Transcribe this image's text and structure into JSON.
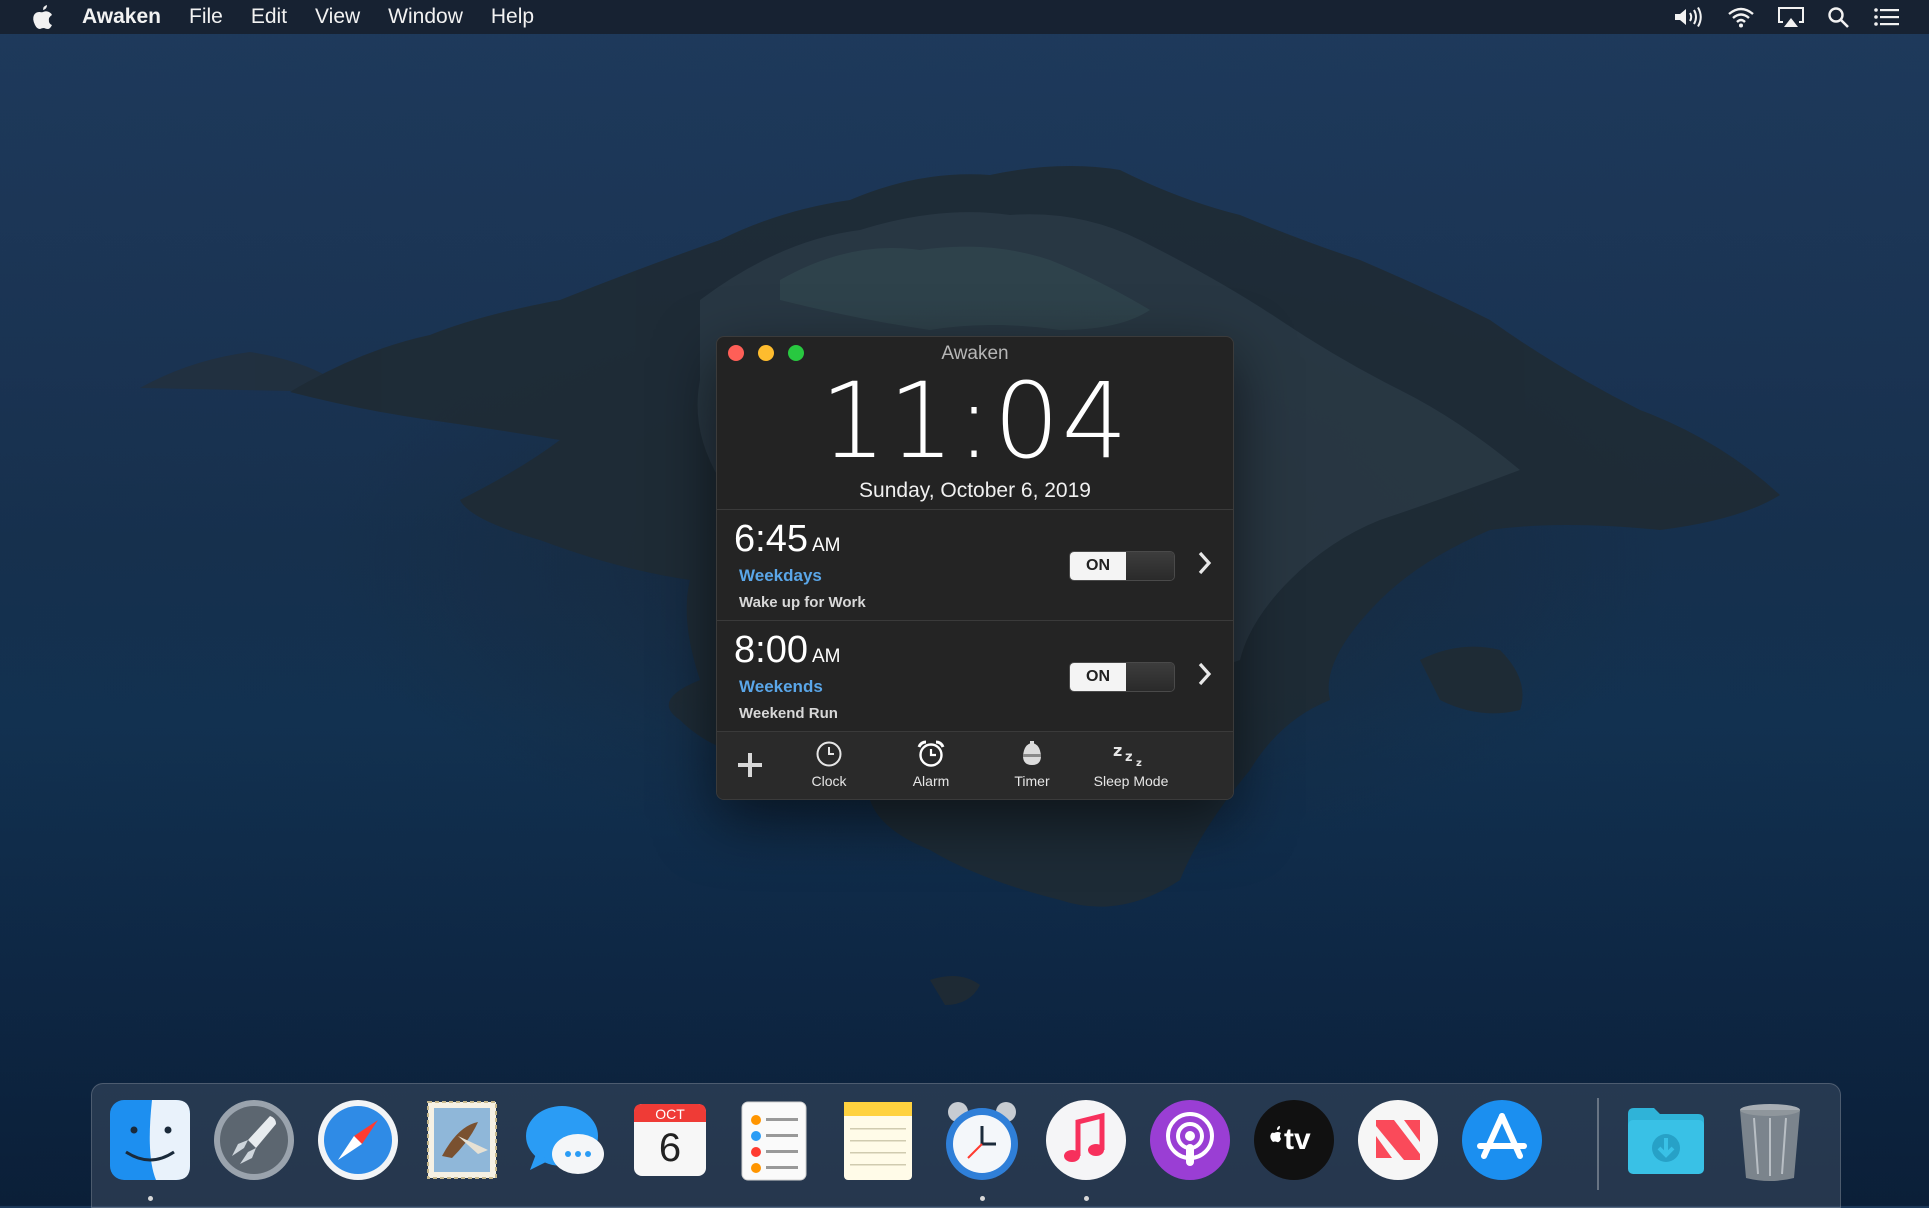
{
  "menubar": {
    "apple_icon": "apple-logo-icon",
    "app_name": "Awaken",
    "items": [
      "File",
      "Edit",
      "View",
      "Window",
      "Help"
    ],
    "status_icons": [
      "volume-icon",
      "wifi-icon",
      "airplay-icon",
      "spotlight-search-icon",
      "notification-center-icon"
    ]
  },
  "window": {
    "title": "Awaken",
    "current_time": "11:04",
    "current_date": "Sunday, October 6, 2019",
    "alarms": [
      {
        "time": "6:45",
        "ampm": "AM",
        "days": "Weekdays",
        "label": "Wake up for Work",
        "state": "ON"
      },
      {
        "time": "8:00",
        "ampm": "AM",
        "days": "Weekends",
        "label": "Weekend Run",
        "state": "ON"
      }
    ],
    "toolbar": {
      "add_icon": "plus-icon",
      "items": [
        {
          "label": "Clock",
          "icon": "clock-icon"
        },
        {
          "label": "Alarm",
          "icon": "alarm-clock-icon"
        },
        {
          "label": "Timer",
          "icon": "egg-timer-icon"
        },
        {
          "label": "Sleep Mode",
          "icon": "zzz-icon"
        }
      ]
    },
    "colors": {
      "accent": "#5aa6e8",
      "background": "#232323"
    }
  },
  "dock": {
    "apps": [
      {
        "name": "Finder",
        "icon": "finder-icon",
        "running": true
      },
      {
        "name": "Launchpad",
        "icon": "launchpad-rocket-icon",
        "running": false
      },
      {
        "name": "Safari",
        "icon": "safari-compass-icon",
        "running": false
      },
      {
        "name": "Mail",
        "icon": "mail-stamp-icon",
        "running": false
      },
      {
        "name": "Messages",
        "icon": "messages-bubble-icon",
        "running": false
      },
      {
        "name": "Calendar",
        "icon": "calendar-icon",
        "running": false,
        "month": "OCT",
        "day": "6"
      },
      {
        "name": "Reminders",
        "icon": "reminders-icon",
        "running": false
      },
      {
        "name": "Notes",
        "icon": "notes-icon",
        "running": false
      },
      {
        "name": "Awaken",
        "icon": "alarm-clock-app-icon",
        "running": true
      },
      {
        "name": "Music",
        "icon": "music-note-icon",
        "running": true
      },
      {
        "name": "Podcasts",
        "icon": "podcasts-icon",
        "running": false
      },
      {
        "name": "TV",
        "icon": "apple-tv-icon",
        "running": false,
        "text": "tv"
      },
      {
        "name": "News",
        "icon": "news-icon",
        "running": false
      },
      {
        "name": "App Store",
        "icon": "app-store-icon",
        "running": false
      },
      {
        "name": "Downloads",
        "icon": "downloads-folder-icon",
        "running": false
      },
      {
        "name": "Trash",
        "icon": "trash-icon",
        "running": false
      }
    ]
  }
}
